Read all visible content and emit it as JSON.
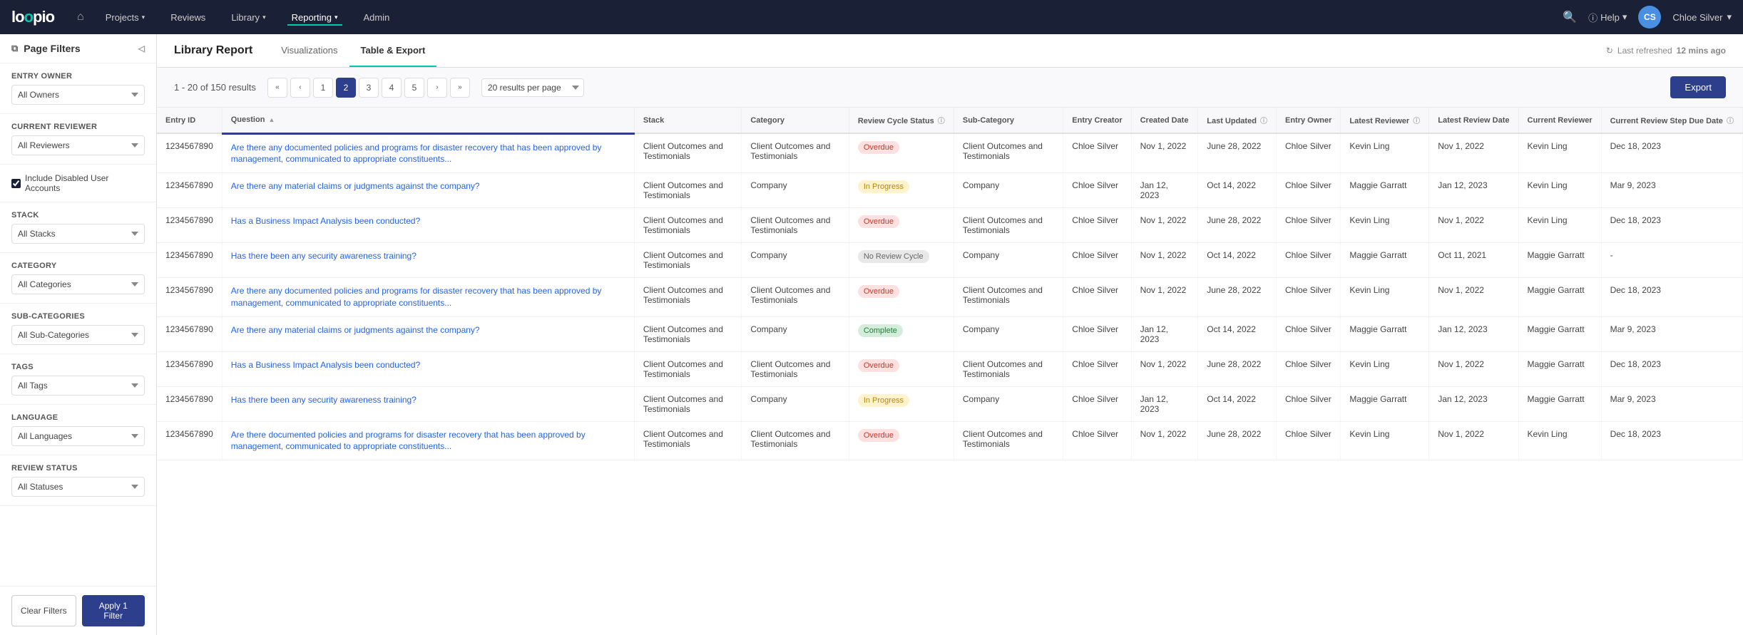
{
  "app": {
    "logo": "loopio",
    "logo_accent": "o"
  },
  "nav": {
    "home_icon": "⌂",
    "items": [
      {
        "label": "Projects",
        "arrow": true,
        "active": false
      },
      {
        "label": "Reviews",
        "arrow": false,
        "active": false
      },
      {
        "label": "Library",
        "arrow": true,
        "active": false
      },
      {
        "label": "Reporting",
        "arrow": true,
        "active": true
      },
      {
        "label": "Admin",
        "arrow": false,
        "active": false
      }
    ],
    "search_icon": "🔍",
    "help_label": "Help",
    "user_initials": "CS",
    "user_name": "Chloe Silver"
  },
  "page": {
    "title": "Library Report",
    "tabs": [
      {
        "label": "Visualizations",
        "active": false
      },
      {
        "label": "Table & Export",
        "active": true
      }
    ],
    "refresh_label": "Last refreshed",
    "refresh_time": "12 mins ago"
  },
  "sidebar": {
    "header": "Page Filters",
    "filter_icon": "≡",
    "sections": [
      {
        "label": "Entry Owner",
        "type": "select",
        "value": "All Owners"
      },
      {
        "label": "Current Reviewer",
        "type": "select",
        "value": "All Reviewers"
      },
      {
        "label": "Include Disabled User Accounts",
        "type": "checkbox",
        "checked": true
      },
      {
        "label": "Stack",
        "type": "select",
        "value": "All Stacks"
      },
      {
        "label": "Category",
        "type": "select",
        "value": "All Categories"
      },
      {
        "label": "Sub-Categories",
        "type": "select",
        "value": "All Sub-Categories"
      },
      {
        "label": "Tags",
        "type": "select",
        "value": "All Tags"
      },
      {
        "label": "Language",
        "type": "select",
        "value": "All Languages"
      },
      {
        "label": "Review Status",
        "type": "select",
        "value": "All Statuses"
      }
    ],
    "clear_btn": "Clear Filters",
    "apply_btn": "Apply 1 Filter"
  },
  "toolbar": {
    "results_text": "1 - 20 of 150 results",
    "pages": [
      "1",
      "2",
      "3",
      "4",
      "5"
    ],
    "current_page": "2",
    "per_page": "20 results per page",
    "export_btn": "Export"
  },
  "table": {
    "columns": [
      "Entry ID",
      "Question",
      "Stack",
      "Category",
      "Review Cycle Status",
      "Sub-Category",
      "Entry Creator",
      "Created Date",
      "Last Updated",
      "Entry Owner",
      "Latest Reviewer",
      "Latest Review Date",
      "Current Reviewer",
      "Current Review Step Due Date"
    ],
    "rows": [
      {
        "entry_id": "1234567890",
        "question": "Are there any documented policies and programs for disaster recovery that has been approved by management, communicated to appropriate constituents...",
        "stack": "Client Outcomes and Testimonials",
        "category": "Client Outcomes and Testimonials",
        "status": "Overdue",
        "status_type": "overdue",
        "sub_category": "Client Outcomes and Testimonials",
        "creator": "Chloe Silver",
        "created": "Nov 1, 2022",
        "last_updated": "June 28, 2022",
        "entry_owner": "Chloe Silver",
        "latest_reviewer": "Kevin Ling",
        "latest_review_date": "Nov 1, 2022",
        "current_reviewer": "Kevin Ling",
        "due_date": "Dec 18, 2023"
      },
      {
        "entry_id": "1234567890",
        "question": "Are there any material claims or judgments against the company?",
        "stack": "Client Outcomes and Testimonials",
        "category": "Company",
        "status": "In Progress",
        "status_type": "in-progress",
        "sub_category": "Company",
        "creator": "Chloe Silver",
        "created": "Jan 12, 2023",
        "last_updated": "Oct 14, 2022",
        "entry_owner": "Chloe Silver",
        "latest_reviewer": "Maggie Garratt",
        "latest_review_date": "Jan 12, 2023",
        "current_reviewer": "Kevin Ling",
        "due_date": "Mar 9, 2023"
      },
      {
        "entry_id": "1234567890",
        "question": "Has a Business Impact Analysis been conducted?",
        "stack": "Client Outcomes and Testimonials",
        "category": "Client Outcomes and Testimonials",
        "status": "Overdue",
        "status_type": "overdue",
        "sub_category": "Client Outcomes and Testimonials",
        "creator": "Chloe Silver",
        "created": "Nov 1, 2022",
        "last_updated": "June 28, 2022",
        "entry_owner": "Chloe Silver",
        "latest_reviewer": "Kevin Ling",
        "latest_review_date": "Nov 1, 2022",
        "current_reviewer": "Kevin Ling",
        "due_date": "Dec 18, 2023"
      },
      {
        "entry_id": "1234567890",
        "question": "Has there been any security awareness training?",
        "stack": "Client Outcomes and Testimonials",
        "category": "Company",
        "status": "No Review Cycle",
        "status_type": "no-review",
        "sub_category": "Company",
        "creator": "Chloe Silver",
        "created": "Nov 1, 2022",
        "last_updated": "Oct 14, 2022",
        "entry_owner": "Chloe Silver",
        "latest_reviewer": "Maggie Garratt",
        "latest_review_date": "Oct 11, 2021",
        "current_reviewer": "Maggie Garratt",
        "due_date": "-"
      },
      {
        "entry_id": "1234567890",
        "question": "Are there any documented policies and programs for disaster recovery that has been approved by management, communicated to appropriate constituents...",
        "stack": "Client Outcomes and Testimonials",
        "category": "Client Outcomes and Testimonials",
        "status": "Overdue",
        "status_type": "overdue",
        "sub_category": "Client Outcomes and Testimonials",
        "creator": "Chloe Silver",
        "created": "Nov 1, 2022",
        "last_updated": "June 28, 2022",
        "entry_owner": "Chloe Silver",
        "latest_reviewer": "Kevin Ling",
        "latest_review_date": "Nov 1, 2022",
        "current_reviewer": "Maggie Garratt",
        "due_date": "Dec 18, 2023"
      },
      {
        "entry_id": "1234567890",
        "question": "Are there any material claims or judgments against the company?",
        "stack": "Client Outcomes and Testimonials",
        "category": "Company",
        "status": "Complete",
        "status_type": "complete",
        "sub_category": "Company",
        "creator": "Chloe Silver",
        "created": "Jan 12, 2023",
        "last_updated": "Oct 14, 2022",
        "entry_owner": "Chloe Silver",
        "latest_reviewer": "Maggie Garratt",
        "latest_review_date": "Jan 12, 2023",
        "current_reviewer": "Maggie Garratt",
        "due_date": "Mar 9, 2023"
      },
      {
        "entry_id": "1234567890",
        "question": "Has a Business Impact Analysis been conducted?",
        "stack": "Client Outcomes and Testimonials",
        "category": "Client Outcomes and Testimonials",
        "status": "Overdue",
        "status_type": "overdue",
        "sub_category": "Client Outcomes and Testimonials",
        "creator": "Chloe Silver",
        "created": "Nov 1, 2022",
        "last_updated": "June 28, 2022",
        "entry_owner": "Chloe Silver",
        "latest_reviewer": "Kevin Ling",
        "latest_review_date": "Nov 1, 2022",
        "current_reviewer": "Maggie Garratt",
        "due_date": "Dec 18, 2023"
      },
      {
        "entry_id": "1234567890",
        "question": "Has there been any security awareness training?",
        "stack": "Client Outcomes and Testimonials",
        "category": "Company",
        "status": "In Progress",
        "status_type": "in-progress",
        "sub_category": "Company",
        "creator": "Chloe Silver",
        "created": "Jan 12, 2023",
        "last_updated": "Oct 14, 2022",
        "entry_owner": "Chloe Silver",
        "latest_reviewer": "Maggie Garratt",
        "latest_review_date": "Jan 12, 2023",
        "current_reviewer": "Maggie Garratt",
        "due_date": "Mar 9, 2023"
      },
      {
        "entry_id": "1234567890",
        "question": "Are there documented policies and programs for disaster recovery that has been approved by management, communicated to appropriate constituents...",
        "stack": "Client Outcomes and Testimonials",
        "category": "Client Outcomes and Testimonials",
        "status": "Overdue",
        "status_type": "overdue",
        "sub_category": "Client Outcomes and Testimonials",
        "creator": "Chloe Silver",
        "created": "Nov 1, 2022",
        "last_updated": "June 28, 2022",
        "entry_owner": "Chloe Silver",
        "latest_reviewer": "Kevin Ling",
        "latest_review_date": "Nov 1, 2022",
        "current_reviewer": "Kevin Ling",
        "due_date": "Dec 18, 2023"
      }
    ]
  }
}
